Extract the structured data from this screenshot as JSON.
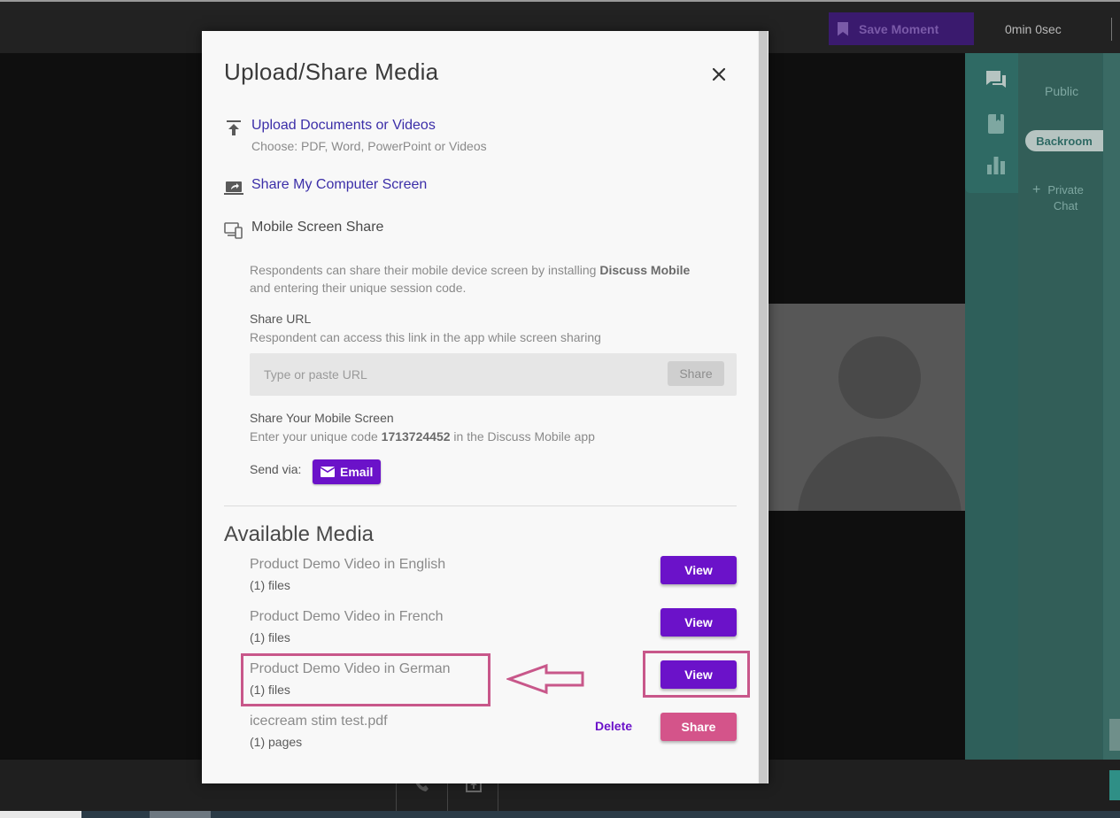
{
  "topbar": {
    "save_moment_label": "Save Moment",
    "timer": "0min 0sec"
  },
  "sidebar": {
    "public_label": "Public",
    "backroom_label": "Backroom",
    "private_chat_line1": "Private",
    "private_chat_line2": "Chat"
  },
  "modal": {
    "title": "Upload/Share Media",
    "upload": {
      "label": "Upload Documents or Videos",
      "sub": "Choose: PDF, Word, PowerPoint or Videos"
    },
    "share_screen": {
      "label": "Share My Computer Screen"
    },
    "mobile": {
      "label": "Mobile Screen Share",
      "desc_pre": "Respondents can share their mobile device screen by installing ",
      "desc_bold": "Discuss Mobile",
      "desc_post": "and entering their unique session code.",
      "share_url_title": "Share URL",
      "share_url_desc": "Respondent can access this link in the app while screen sharing",
      "url_placeholder": "Type or paste URL",
      "url_share_label": "Share",
      "share_screen_title": "Share Your Mobile Screen",
      "code_pre": "Enter your unique code ",
      "code": "1713724452",
      "code_post": " in the Discuss Mobile app",
      "send_via": "Send via:",
      "email_label": "Email"
    },
    "available_title": "Available Media",
    "media": [
      {
        "name": "Product Demo Video in English",
        "count": "(1) files",
        "action": "View"
      },
      {
        "name": "Product Demo Video in French",
        "count": "(1) files",
        "action": "View"
      },
      {
        "name": "Product Demo Video in German",
        "count": "(1) files",
        "action": "View"
      },
      {
        "name": "icecream stim test.pdf",
        "count": "(1) pages",
        "action": "Share",
        "delete_label": "Delete"
      }
    ]
  },
  "colors": {
    "purple": "#6b12c9",
    "pink": "#d4548a",
    "link_blue": "#3b2ea8",
    "teal": "#2f6a64",
    "annotation": "#c8578a"
  },
  "icons": [
    "upload-icon",
    "screen-share-icon",
    "mobile-screen-icon",
    "close-icon",
    "email-icon",
    "chat-icon",
    "notebook-icon",
    "poll-icon",
    "bookmark-icon",
    "phone-icon",
    "upload-tray-icon",
    "plus-icon"
  ]
}
